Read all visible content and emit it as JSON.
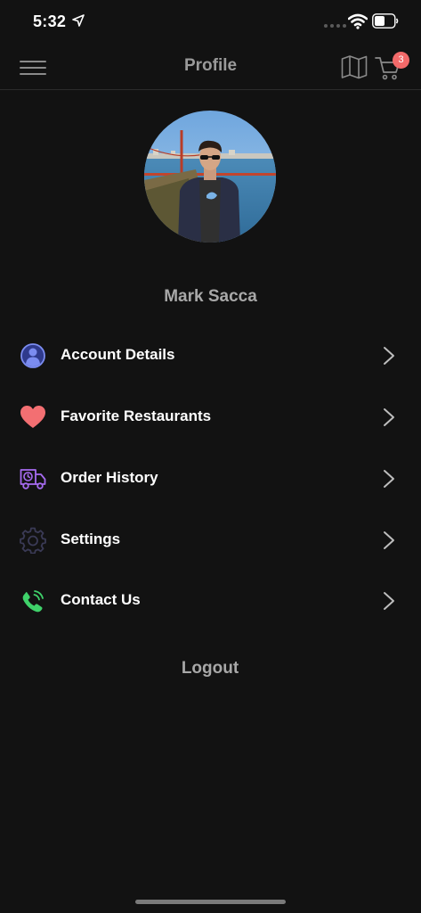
{
  "status_bar": {
    "time": "5:32"
  },
  "nav": {
    "title": "Profile",
    "cart_count": "3"
  },
  "profile": {
    "name": "Mark Sacca"
  },
  "menu": {
    "items": [
      {
        "label": "Account Details",
        "icon": "user-icon",
        "color": "#7b8cf0"
      },
      {
        "label": "Favorite Restaurants",
        "icon": "heart-icon",
        "color": "#f36f72"
      },
      {
        "label": "Order History",
        "icon": "delivery-truck-icon",
        "color": "#a66bf0"
      },
      {
        "label": "Settings",
        "icon": "gear-icon",
        "color": "#3a3a55"
      },
      {
        "label": "Contact Us",
        "icon": "phone-icon",
        "color": "#3fd16a"
      }
    ]
  },
  "logout_label": "Logout",
  "colors": {
    "background": "#121212",
    "badge": "#f36a6a",
    "title_gray": "#9a9a9a"
  }
}
